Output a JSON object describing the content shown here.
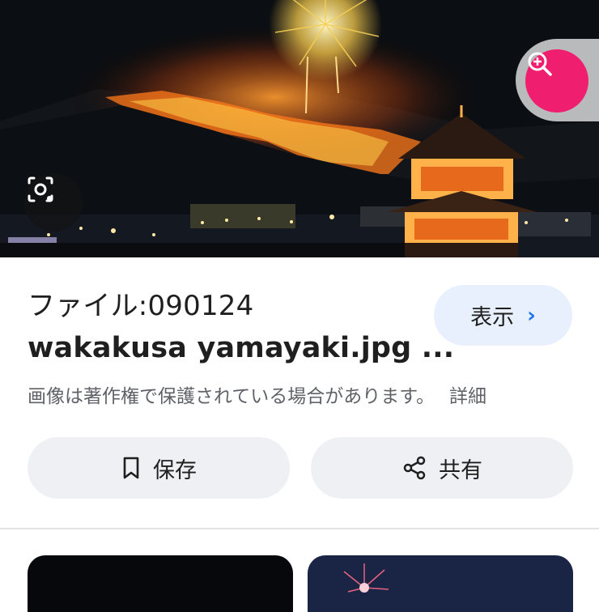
{
  "hero_image": {
    "alt": "wakakusa yamayaki fireworks over temple"
  },
  "buttons": {
    "lens_icon": "lens-camera-icon",
    "zoom_icon": "zoom-in-icon"
  },
  "result": {
    "title_line1": "ファイル:090124",
    "title_line2": "wakakusa yamayaki.jpg ...",
    "view_label": "表示",
    "view_chevron": "›",
    "notice": "画像は著作権で保護されている場合があります。",
    "detail_link": "詳細"
  },
  "actions": {
    "save_label": "保存",
    "share_label": "共有"
  },
  "colors": {
    "accent_pink": "#f01e6e",
    "link_blue": "#1a73e8",
    "view_bg": "#e8f0fd"
  }
}
